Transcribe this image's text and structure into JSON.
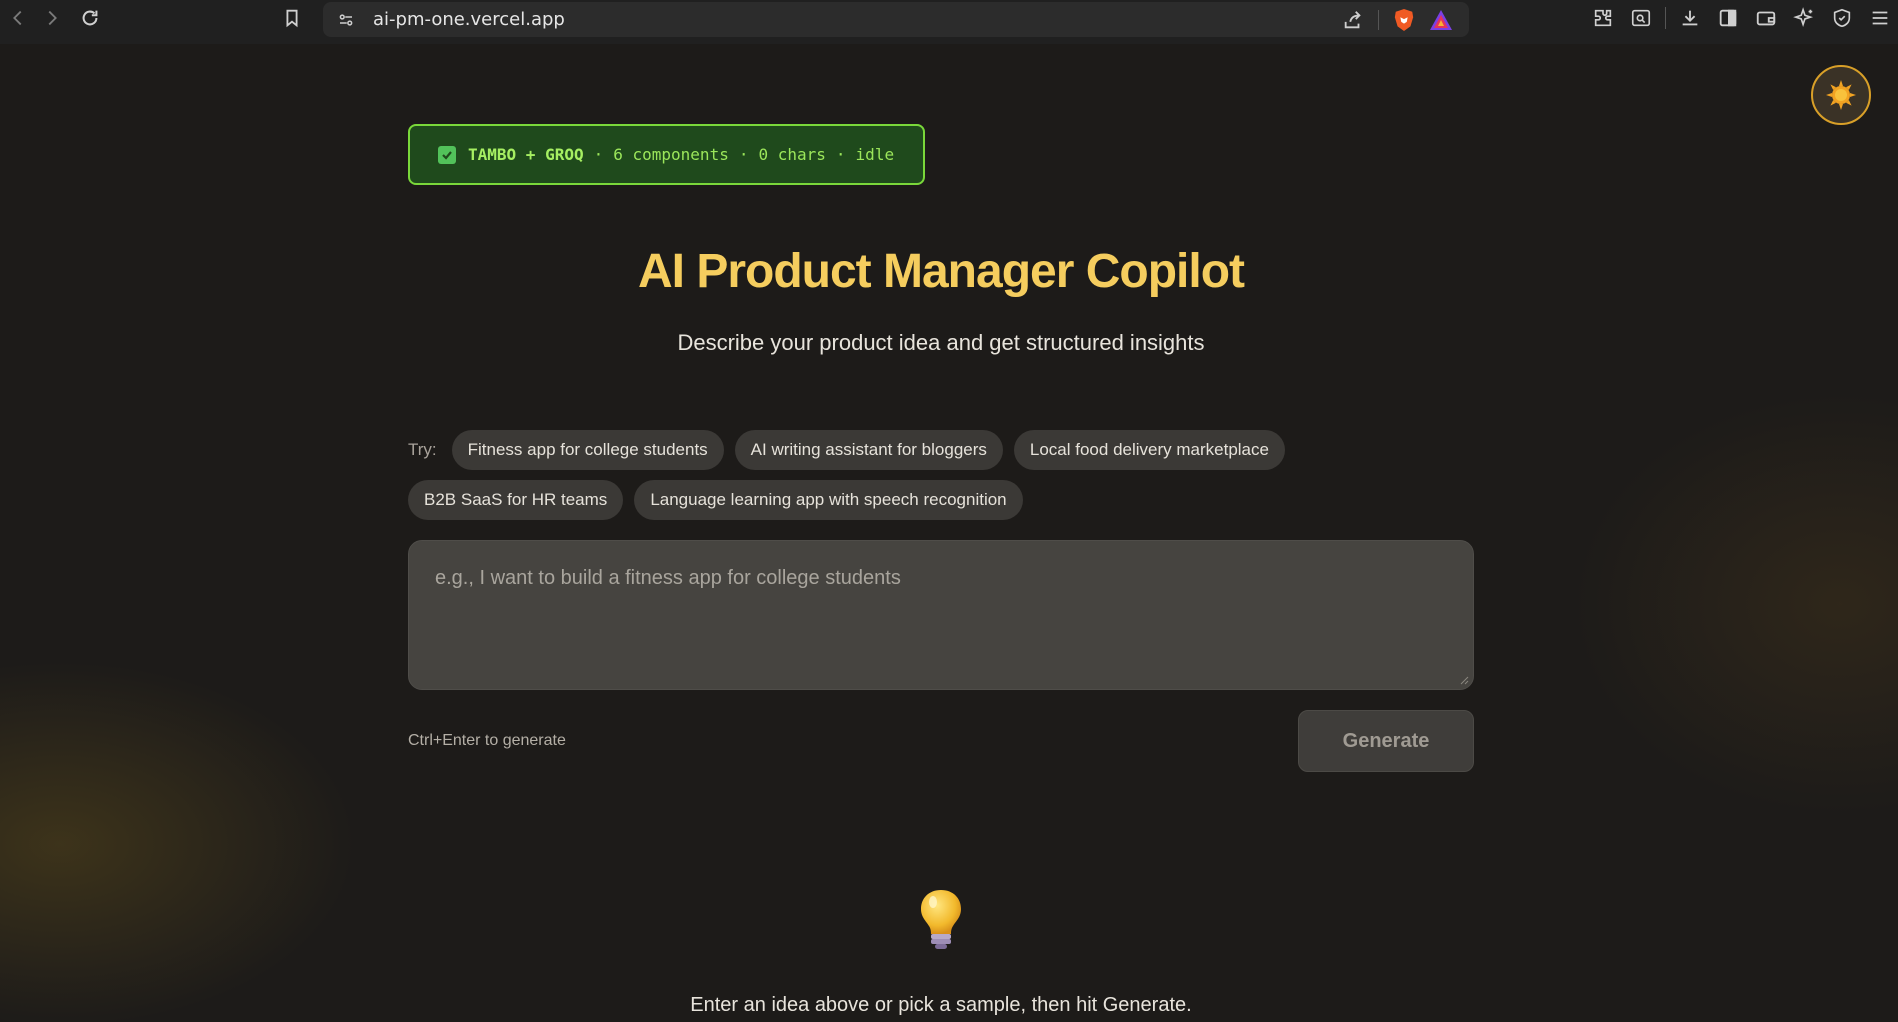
{
  "browser": {
    "url": "ai-pm-one.vercel.app"
  },
  "status": {
    "brand": "TAMBO + GROQ",
    "components": "6 components",
    "chars": "0 chars",
    "state": "idle",
    "separator": "·"
  },
  "header": {
    "title": "AI Product Manager Copilot",
    "subtitle": "Describe your product idea and get structured insights"
  },
  "samples": {
    "label": "Try:",
    "items": [
      "Fitness app for college students",
      "AI writing assistant for bloggers",
      "Local food delivery marketplace",
      "B2B SaaS for HR teams",
      "Language learning app with speech recognition"
    ]
  },
  "input": {
    "placeholder": "e.g., I want to build a fitness app for college students",
    "value": ""
  },
  "actions": {
    "hint": "Ctrl+Enter to generate",
    "generate_label": "Generate"
  },
  "empty_state": {
    "message": "Enter an idea above or pick a sample, then hit Generate."
  },
  "colors": {
    "accent_title": "#f5cd5e",
    "status_green": "#7ad83a",
    "toggle_ring": "#d9a028"
  }
}
